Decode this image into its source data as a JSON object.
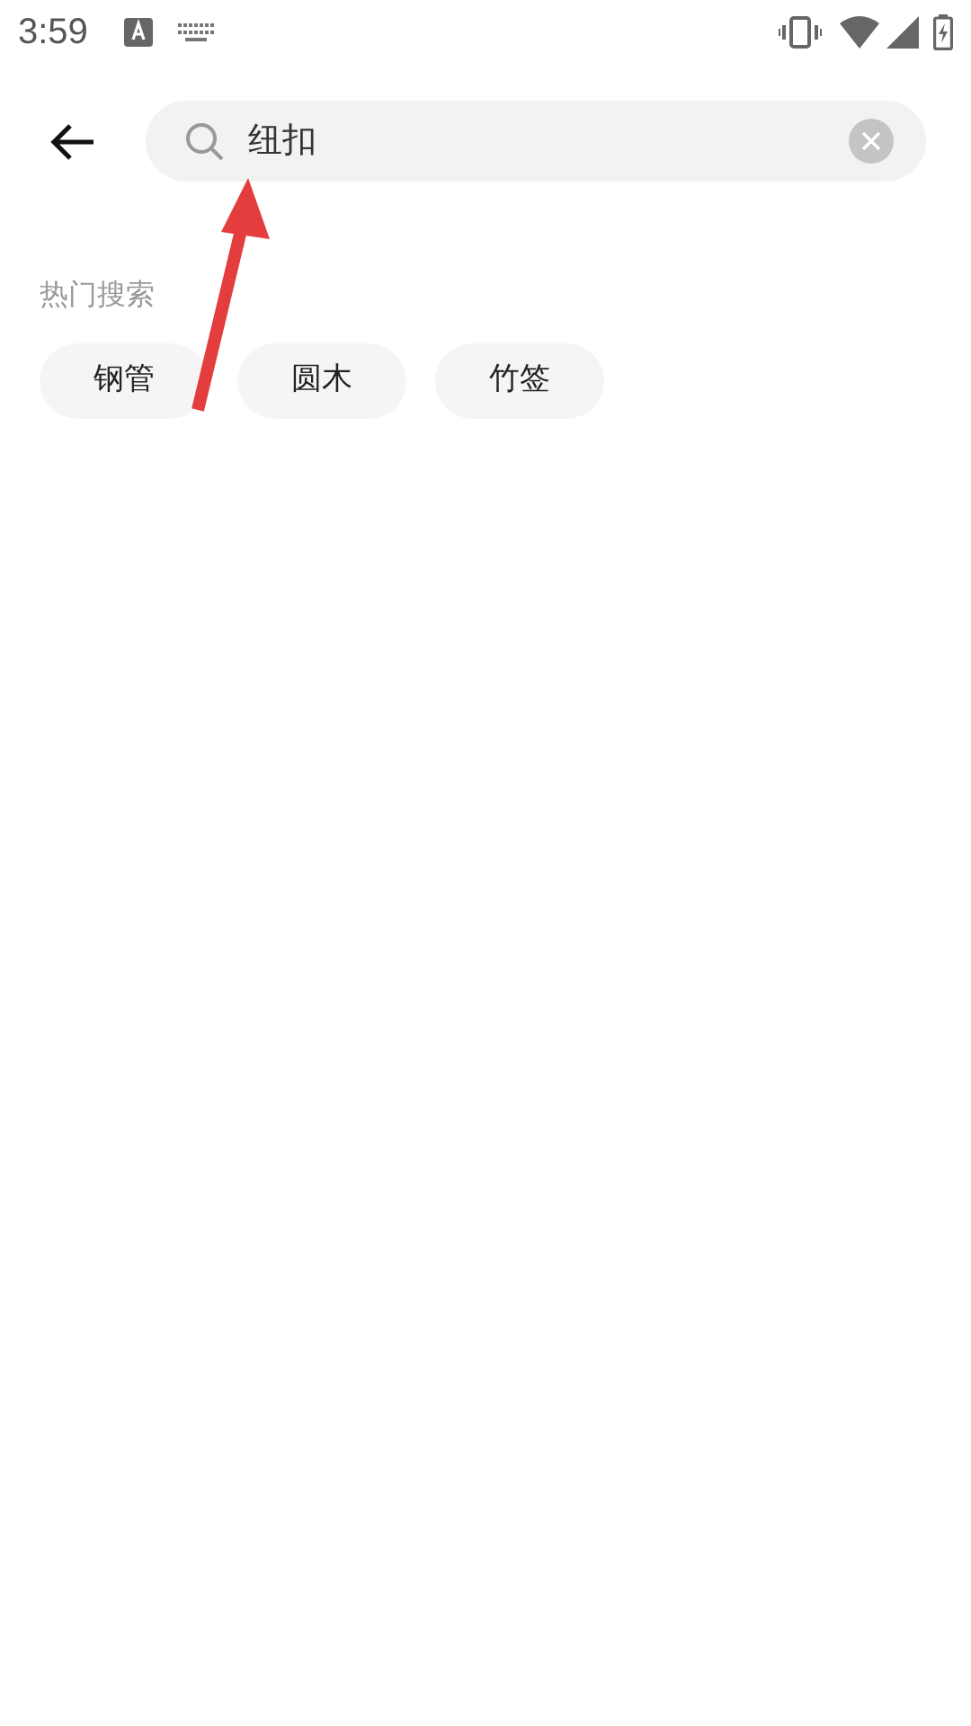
{
  "status_bar": {
    "time": "3:59"
  },
  "search": {
    "value": "纽扣"
  },
  "hot_search": {
    "title": "热门搜索",
    "tags": [
      "钢管",
      "圆木",
      "竹签"
    ]
  }
}
